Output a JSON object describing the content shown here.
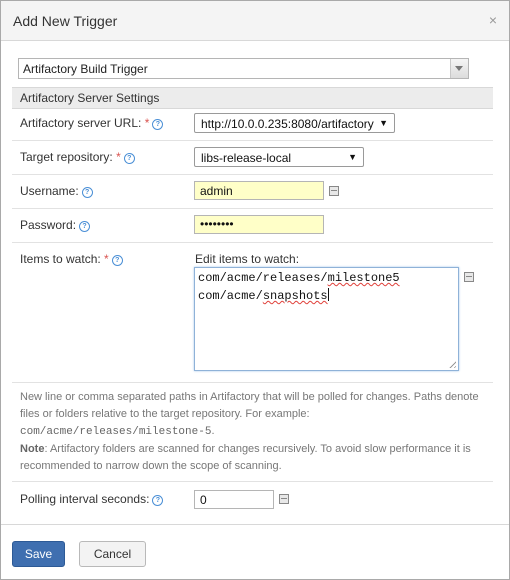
{
  "dialog": {
    "title": "Add New Trigger",
    "close_glyph": "×"
  },
  "trigger_type": {
    "selected": "Artifactory Build Trigger"
  },
  "section": {
    "title": "Artifactory Server Settings"
  },
  "fields": {
    "server_url": {
      "label": "Artifactory server URL:",
      "required_mark": "*",
      "value": "http://10.0.0.235:8080/artifactory"
    },
    "target_repo": {
      "label": "Target repository:",
      "required_mark": "*",
      "value": "libs-release-local"
    },
    "username": {
      "label": "Username:",
      "value": "admin"
    },
    "password": {
      "label": "Password:",
      "value": "••••••••"
    },
    "items_to_watch": {
      "label": "Items to watch:",
      "required_mark": "*",
      "edit_label": "Edit items to watch:",
      "line1_prefix": "com/acme/releases/",
      "line1_misspelled": "milestone5",
      "line2_prefix": "com/acme/",
      "line2_misspelled": "snapshots"
    },
    "polling": {
      "label": "Polling interval seconds:",
      "value": "0"
    }
  },
  "help_text": {
    "para1": "New line or comma separated paths in Artifactory that will be polled for changes. Paths denote files or folders relative to the target repository. For example:",
    "example_code": "com/acme/releases/milestone-5",
    "example_suffix": ".",
    "note_label": "Note",
    "note_text": ": Artifactory folders are scanned for changes recursively. To avoid slow performance it is recommended to narrow down the scope of scanning."
  },
  "buttons": {
    "save": "Save",
    "cancel": "Cancel"
  },
  "icons": {
    "help": "?",
    "caret": "▼"
  },
  "colors": {
    "primary_button": "#3f6fb0",
    "input_highlight": "#ffffc8",
    "required": "#d9534f",
    "help_icon": "#4a8fd6"
  }
}
